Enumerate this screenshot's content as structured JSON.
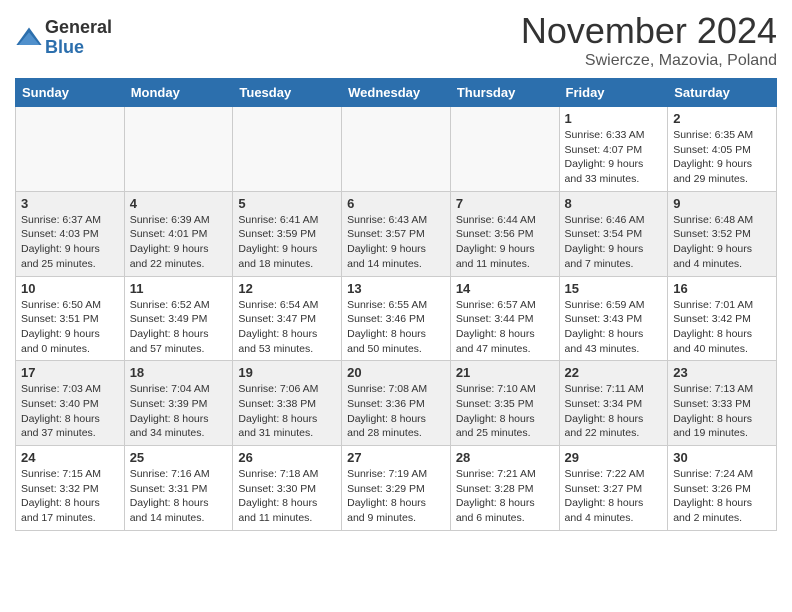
{
  "logo": {
    "general": "General",
    "blue": "Blue"
  },
  "title": "November 2024",
  "location": "Swiercze, Mazovia, Poland",
  "headers": [
    "Sunday",
    "Monday",
    "Tuesday",
    "Wednesday",
    "Thursday",
    "Friday",
    "Saturday"
  ],
  "weeks": [
    [
      {
        "day": "",
        "info": ""
      },
      {
        "day": "",
        "info": ""
      },
      {
        "day": "",
        "info": ""
      },
      {
        "day": "",
        "info": ""
      },
      {
        "day": "",
        "info": ""
      },
      {
        "day": "1",
        "info": "Sunrise: 6:33 AM\nSunset: 4:07 PM\nDaylight: 9 hours and 33 minutes."
      },
      {
        "day": "2",
        "info": "Sunrise: 6:35 AM\nSunset: 4:05 PM\nDaylight: 9 hours and 29 minutes."
      }
    ],
    [
      {
        "day": "3",
        "info": "Sunrise: 6:37 AM\nSunset: 4:03 PM\nDaylight: 9 hours and 25 minutes."
      },
      {
        "day": "4",
        "info": "Sunrise: 6:39 AM\nSunset: 4:01 PM\nDaylight: 9 hours and 22 minutes."
      },
      {
        "day": "5",
        "info": "Sunrise: 6:41 AM\nSunset: 3:59 PM\nDaylight: 9 hours and 18 minutes."
      },
      {
        "day": "6",
        "info": "Sunrise: 6:43 AM\nSunset: 3:57 PM\nDaylight: 9 hours and 14 minutes."
      },
      {
        "day": "7",
        "info": "Sunrise: 6:44 AM\nSunset: 3:56 PM\nDaylight: 9 hours and 11 minutes."
      },
      {
        "day": "8",
        "info": "Sunrise: 6:46 AM\nSunset: 3:54 PM\nDaylight: 9 hours and 7 minutes."
      },
      {
        "day": "9",
        "info": "Sunrise: 6:48 AM\nSunset: 3:52 PM\nDaylight: 9 hours and 4 minutes."
      }
    ],
    [
      {
        "day": "10",
        "info": "Sunrise: 6:50 AM\nSunset: 3:51 PM\nDaylight: 9 hours and 0 minutes."
      },
      {
        "day": "11",
        "info": "Sunrise: 6:52 AM\nSunset: 3:49 PM\nDaylight: 8 hours and 57 minutes."
      },
      {
        "day": "12",
        "info": "Sunrise: 6:54 AM\nSunset: 3:47 PM\nDaylight: 8 hours and 53 minutes."
      },
      {
        "day": "13",
        "info": "Sunrise: 6:55 AM\nSunset: 3:46 PM\nDaylight: 8 hours and 50 minutes."
      },
      {
        "day": "14",
        "info": "Sunrise: 6:57 AM\nSunset: 3:44 PM\nDaylight: 8 hours and 47 minutes."
      },
      {
        "day": "15",
        "info": "Sunrise: 6:59 AM\nSunset: 3:43 PM\nDaylight: 8 hours and 43 minutes."
      },
      {
        "day": "16",
        "info": "Sunrise: 7:01 AM\nSunset: 3:42 PM\nDaylight: 8 hours and 40 minutes."
      }
    ],
    [
      {
        "day": "17",
        "info": "Sunrise: 7:03 AM\nSunset: 3:40 PM\nDaylight: 8 hours and 37 minutes."
      },
      {
        "day": "18",
        "info": "Sunrise: 7:04 AM\nSunset: 3:39 PM\nDaylight: 8 hours and 34 minutes."
      },
      {
        "day": "19",
        "info": "Sunrise: 7:06 AM\nSunset: 3:38 PM\nDaylight: 8 hours and 31 minutes."
      },
      {
        "day": "20",
        "info": "Sunrise: 7:08 AM\nSunset: 3:36 PM\nDaylight: 8 hours and 28 minutes."
      },
      {
        "day": "21",
        "info": "Sunrise: 7:10 AM\nSunset: 3:35 PM\nDaylight: 8 hours and 25 minutes."
      },
      {
        "day": "22",
        "info": "Sunrise: 7:11 AM\nSunset: 3:34 PM\nDaylight: 8 hours and 22 minutes."
      },
      {
        "day": "23",
        "info": "Sunrise: 7:13 AM\nSunset: 3:33 PM\nDaylight: 8 hours and 19 minutes."
      }
    ],
    [
      {
        "day": "24",
        "info": "Sunrise: 7:15 AM\nSunset: 3:32 PM\nDaylight: 8 hours and 17 minutes."
      },
      {
        "day": "25",
        "info": "Sunrise: 7:16 AM\nSunset: 3:31 PM\nDaylight: 8 hours and 14 minutes."
      },
      {
        "day": "26",
        "info": "Sunrise: 7:18 AM\nSunset: 3:30 PM\nDaylight: 8 hours and 11 minutes."
      },
      {
        "day": "27",
        "info": "Sunrise: 7:19 AM\nSunset: 3:29 PM\nDaylight: 8 hours and 9 minutes."
      },
      {
        "day": "28",
        "info": "Sunrise: 7:21 AM\nSunset: 3:28 PM\nDaylight: 8 hours and 6 minutes."
      },
      {
        "day": "29",
        "info": "Sunrise: 7:22 AM\nSunset: 3:27 PM\nDaylight: 8 hours and 4 minutes."
      },
      {
        "day": "30",
        "info": "Sunrise: 7:24 AM\nSunset: 3:26 PM\nDaylight: 8 hours and 2 minutes."
      }
    ]
  ]
}
